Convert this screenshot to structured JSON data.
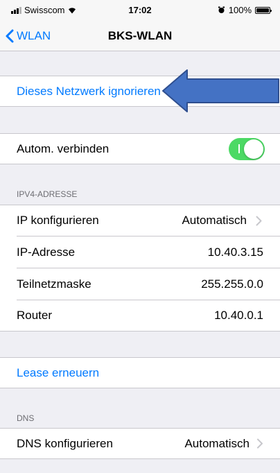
{
  "status_bar": {
    "carrier": "Swisscom",
    "time": "17:02",
    "battery": "100%",
    "signal_bars_filled": 3,
    "signal_bars_total": 4
  },
  "nav": {
    "back_label": "WLAN",
    "title": "BKS-WLAN"
  },
  "forget_network": {
    "label": "Dieses Netzwerk ignorieren"
  },
  "auto_join": {
    "label": "Autom. verbinden",
    "enabled": true
  },
  "ipv4": {
    "header": "IPV4-ADRESSE",
    "configure": {
      "label": "IP konfigurieren",
      "value": "Automatisch"
    },
    "address": {
      "label": "IP-Adresse",
      "value": "10.40.3.15"
    },
    "subnet": {
      "label": "Teilnetzmaske",
      "value": "255.255.0.0"
    },
    "router": {
      "label": "Router",
      "value": "10.40.0.1"
    }
  },
  "renew_lease": {
    "label": "Lease erneuern"
  },
  "dns": {
    "header": "DNS",
    "configure": {
      "label": "DNS konfigurieren",
      "value": "Automatisch"
    }
  },
  "colors": {
    "accent": "#007aff",
    "toggle_on": "#4cd964",
    "arrow_fill": "#4472c4",
    "arrow_border": "#2f4f8f"
  }
}
